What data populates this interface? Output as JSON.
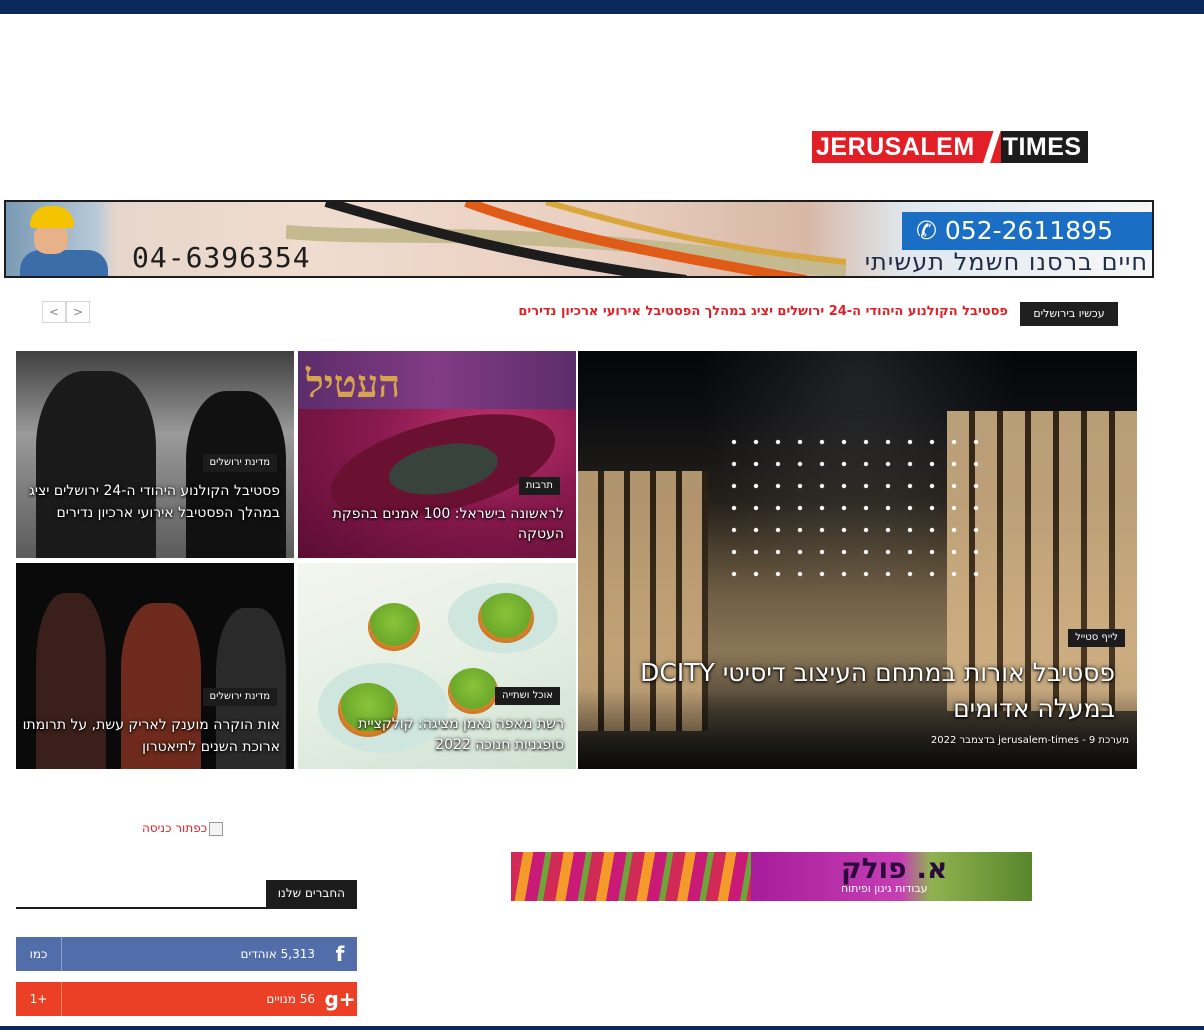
{
  "logo": {
    "left": "JERUSALEM",
    "right": "TIMES"
  },
  "banner": {
    "phone_left": "04-6396354",
    "phone_right": "052-2611895",
    "business": "חיים ברסנו חשמל תעשיתי"
  },
  "ticker": {
    "label": "עכשיו בירושלים",
    "headline": "פסטיבל הקולנוע היהודי ה-24 ירושלים יציג במהלך הפסטיבל אירועי ארכיון נדירים",
    "prev": "<",
    "next": ">"
  },
  "tiles": {
    "main": {
      "category": "לייף סטייל",
      "title": "פסטיבל אורות במתחם העיצוב דיסיטי DCITY במעלה אדומים",
      "meta": "מערכת jerusalem-times - 9 בדצמבר 2022"
    },
    "b": {
      "category": "תרבות",
      "title": "לראשונה בישראל: 100 אמנים בהפקת העטקה"
    },
    "c": {
      "category": "מדינת ירושלים",
      "title": "פסטיבל הקולנוע היהודי ה-24 ירושלים יציג במהלך הפסטיבל אירועי ארכיון נדירים"
    },
    "d": {
      "category": "אוכל ושתייה",
      "title": "רשת מאפה נאמן מציגה: קולקציית סופגניות חנוכה 2022"
    },
    "e": {
      "category": "מדינת ירושלים",
      "title": "אות הוקרה מוענק לאריק עשת, על תרומתו ארוכת השנים לתיאטרון"
    }
  },
  "entry_button_alt": "כפתור כניסה",
  "ad2": {
    "title": "א. פולק",
    "subtitle": "עבודות גינון ופיתוח"
  },
  "partners": {
    "heading": "החברים שלנו",
    "facebook": {
      "count": "5,313",
      "unit": "אוהדים",
      "action": "כמו"
    },
    "gplus": {
      "count": "56",
      "unit": "מנויים",
      "action": "1+"
    }
  },
  "colors": {
    "brand_red": "#e21f26",
    "navy": "#0b2a5c",
    "facebook": "#516eab",
    "gplus": "#eb4026"
  }
}
